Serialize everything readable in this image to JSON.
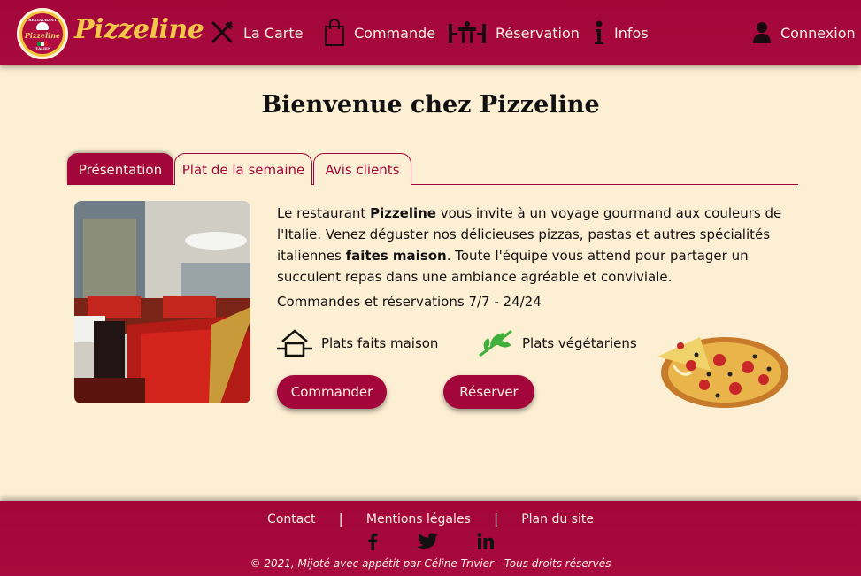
{
  "header": {
    "logo": {
      "top_text": "RESTAURANT",
      "name": "Pizzeline",
      "bottom_text": "ITALIEN"
    },
    "brand": "Pizzeline",
    "nav": [
      {
        "label": "La Carte",
        "icon": "fork-knife-icon"
      },
      {
        "label": "Commande",
        "icon": "shopping-bag-icon"
      },
      {
        "label": "Réservation",
        "icon": "table-chairs-icon"
      },
      {
        "label": "Infos",
        "icon": "info-icon"
      }
    ],
    "login": {
      "label": "Connexion",
      "icon": "user-icon"
    }
  },
  "main": {
    "title": "Bienvenue chez Pizzeline",
    "tabs": [
      {
        "label": "Présentation"
      },
      {
        "label": "Plat de la semaine"
      },
      {
        "label": "Avis clients"
      }
    ],
    "description": {
      "p1": "Le restaurant ",
      "strong1": "Pizzeline",
      "p2": " vous invite à un voyage gourmand aux couleurs de l'Italie. Venez déguster nos délicieuses pizzas, pastas et autres spécialités italiennes ",
      "strong2": "faites maison",
      "p3": ". Toute l'équipe vous attend pour partager un succulent repas dans une ambiance agréable et conviviale."
    },
    "hours": "Commandes et réservations 7/7 - 24/24",
    "features": [
      {
        "label": "Plats faits maison",
        "icon": "house-icon"
      },
      {
        "label": "Plats végétariens",
        "icon": "leaf-icon"
      }
    ],
    "buttons": {
      "order": "Commander",
      "reserve": "Réserver"
    }
  },
  "footer": {
    "links": [
      "Contact",
      "Mentions légales",
      "Plan du site"
    ],
    "separator": "|",
    "socials": [
      {
        "icon": "facebook-icon"
      },
      {
        "icon": "twitter-icon"
      },
      {
        "icon": "linkedin-icon"
      }
    ],
    "copyright": "© 2021, Mijoté avec appétit par Céline Trivier - Tous droits réservés"
  },
  "colors": {
    "brand": "#a3063a",
    "background": "#fdefd3",
    "accent": "#f4c64a"
  }
}
